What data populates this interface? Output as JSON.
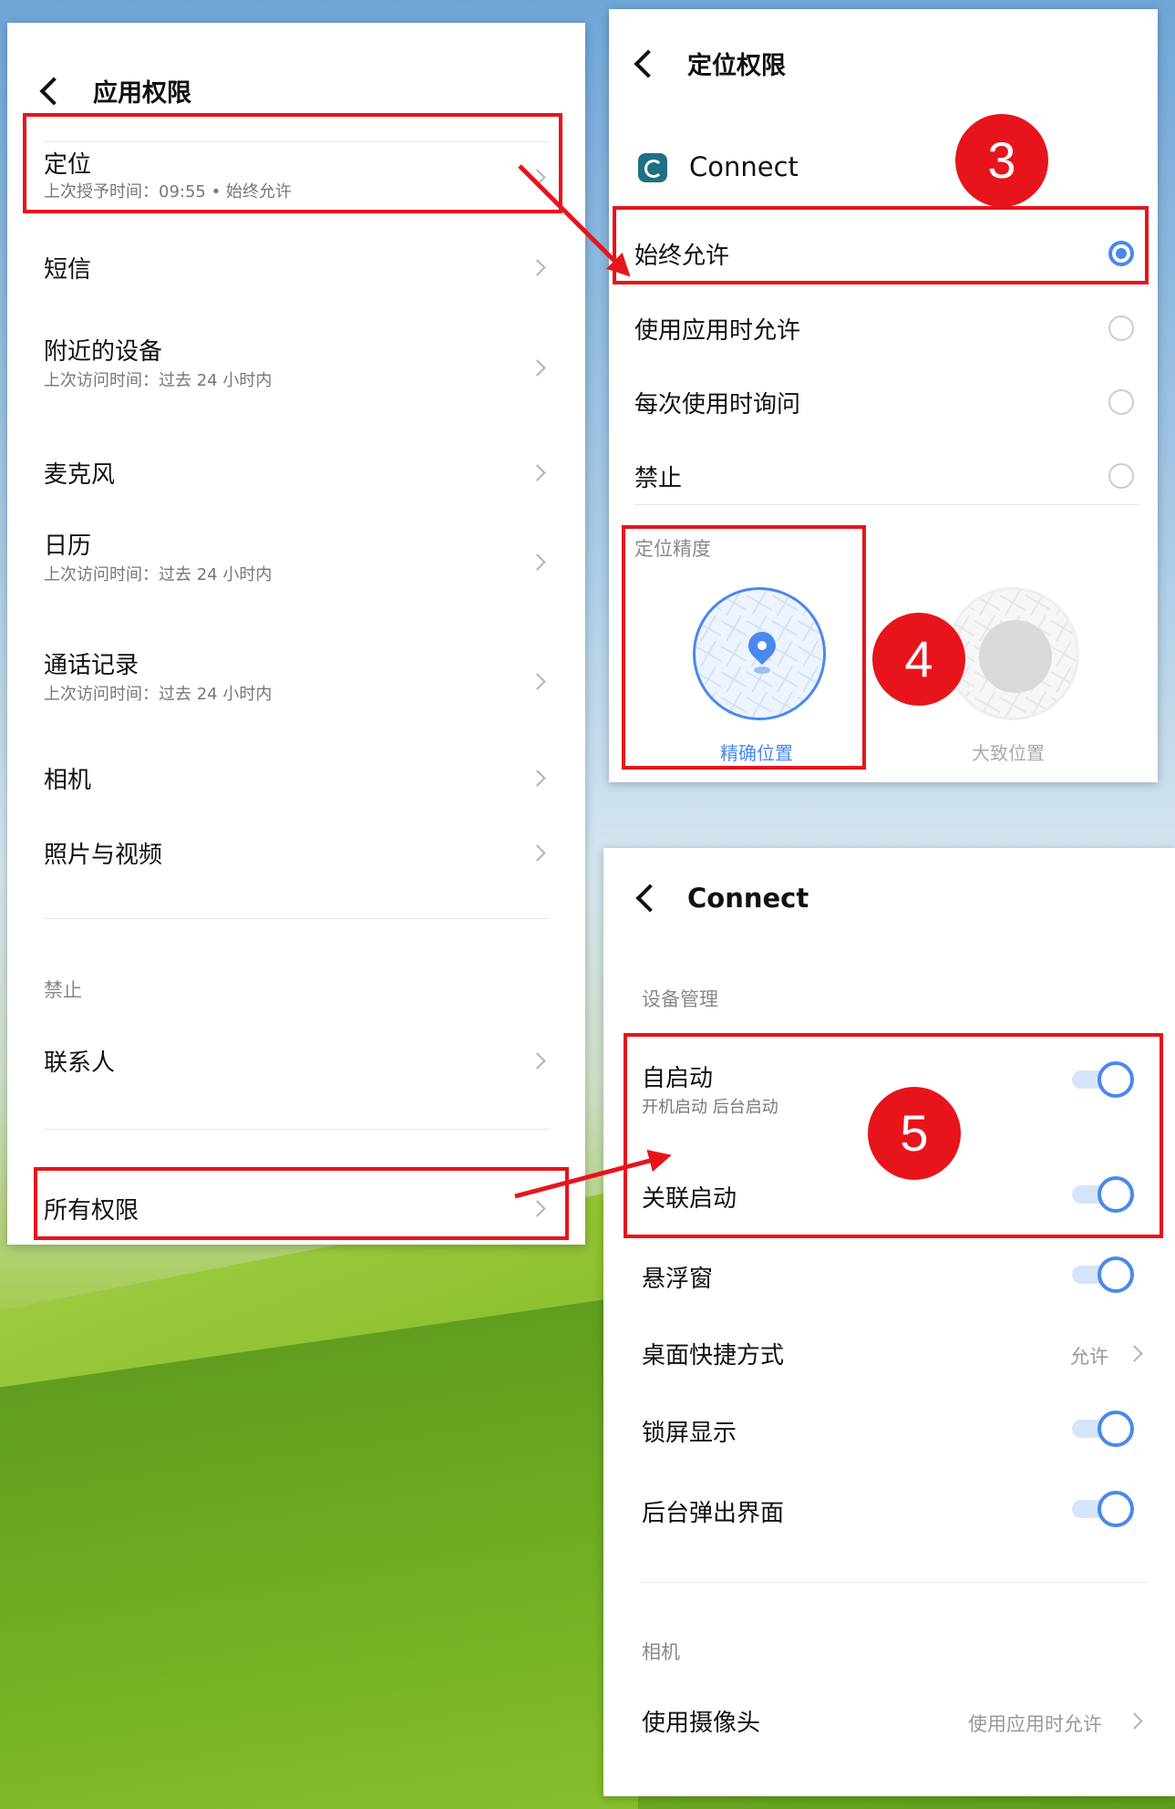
{
  "left_panel": {
    "title": "应用权限",
    "items": [
      {
        "title": "定位",
        "subtitle": "上次授予时间：09:55 • 始终允许"
      },
      {
        "title": "短信",
        "subtitle": ""
      },
      {
        "title": "附近的设备",
        "subtitle": "上次访问时间：过去 24 小时内"
      },
      {
        "title": "麦克风",
        "subtitle": ""
      },
      {
        "title": "日历",
        "subtitle": "上次访问时间：过去 24 小时内"
      },
      {
        "title": "通话记录",
        "subtitle": "上次访问时间：过去 24 小时内"
      },
      {
        "title": "相机",
        "subtitle": ""
      },
      {
        "title": "照片与视频",
        "subtitle": ""
      }
    ],
    "denied_label": "禁止",
    "denied_items": [
      {
        "title": "联系人"
      }
    ],
    "all_permissions": "所有权限"
  },
  "right_panel": {
    "title": "定位权限",
    "app_name": "Connect",
    "options": [
      {
        "label": "始终允许",
        "selected": true
      },
      {
        "label": "使用应用时允许",
        "selected": false
      },
      {
        "label": "每次使用时询问",
        "selected": false
      },
      {
        "label": "禁止",
        "selected": false
      }
    ],
    "precision_label": "定位精度",
    "precise_label": "精确位置",
    "approximate_label": "大致位置"
  },
  "bottom_panel": {
    "title": "Connect",
    "section_device": "设备管理",
    "items": [
      {
        "title": "自启动",
        "subtitle": "开机启动  后台启动",
        "toggle": true
      },
      {
        "title": "关联启动",
        "subtitle": "",
        "toggle": true
      },
      {
        "title": "悬浮窗",
        "subtitle": "",
        "toggle": true
      },
      {
        "title": "桌面快捷方式",
        "value": "允许"
      },
      {
        "title": "锁屏显示",
        "subtitle": "",
        "toggle": true
      },
      {
        "title": "后台弹出界面",
        "subtitle": "",
        "toggle": true
      }
    ],
    "section_camera": "相机",
    "camera_item": {
      "title": "使用摄像头",
      "value": "使用应用时允许"
    }
  },
  "badges": [
    "3",
    "4",
    "5"
  ],
  "colors": {
    "accent": "#4a88ee",
    "highlight": "#e8141b"
  }
}
